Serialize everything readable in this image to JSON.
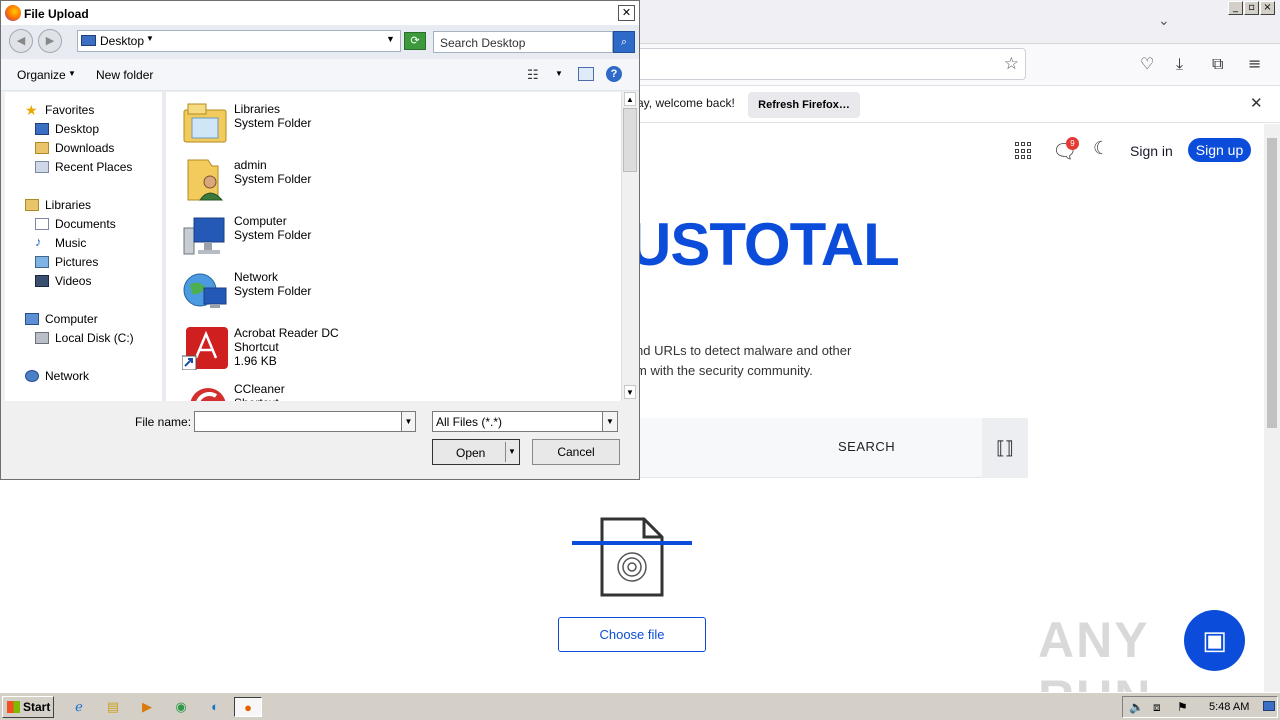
{
  "browser": {
    "notification": {
      "text": "ay, welcome back!",
      "refresh_label": "Refresh Firefox…",
      "close_icon": "close-icon"
    },
    "navbar": {
      "icons": [
        "bookmark-star-icon",
        "pocket-icon",
        "downloads-icon",
        "extensions-icon",
        "menu-icon"
      ]
    }
  },
  "page": {
    "header": {
      "notification_badge": "9",
      "signin_label": "Sign in",
      "signup_label": "Sign up"
    },
    "logo_text": "USTOTAL",
    "description": [
      "nd URLs to detect malware and other",
      "m with the security community."
    ],
    "search_label": "SEARCH",
    "choose_file_label": "Choose file",
    "watermark": "ANY RUN",
    "brand_color": "#0b4dda"
  },
  "dialog": {
    "title": "File Upload",
    "address": "Desktop",
    "search_placeholder": "Search Desktop",
    "toolbar": {
      "organize_label": "Organize",
      "new_folder_label": "New folder"
    },
    "nav": {
      "favorites": "Favorites",
      "favorites_items": [
        "Desktop",
        "Downloads",
        "Recent Places"
      ],
      "libraries": "Libraries",
      "libraries_items": [
        "Documents",
        "Music",
        "Pictures",
        "Videos"
      ],
      "computer": "Computer",
      "computer_items": [
        "Local Disk (C:)"
      ],
      "network": "Network"
    },
    "files": [
      {
        "name": "Libraries",
        "type": "System Folder",
        "size": ""
      },
      {
        "name": "admin",
        "type": "System Folder",
        "size": ""
      },
      {
        "name": "Computer",
        "type": "System Folder",
        "size": ""
      },
      {
        "name": "Network",
        "type": "System Folder",
        "size": ""
      },
      {
        "name": "Acrobat Reader DC",
        "type": "Shortcut",
        "size": "1.96 KB"
      },
      {
        "name": "CCleaner",
        "type": "Shortcut",
        "size": ""
      }
    ],
    "filename_label": "File name:",
    "filename_value": "",
    "filetype_value": "All Files (*.*)",
    "open_label": "Open",
    "cancel_label": "Cancel"
  },
  "taskbar": {
    "start_label": "Start",
    "clock": "5:48 AM"
  }
}
